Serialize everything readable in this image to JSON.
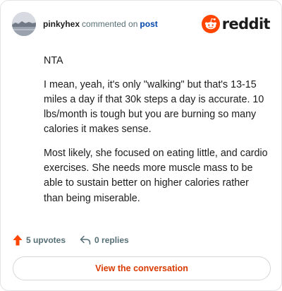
{
  "header": {
    "username": "pinkyhex",
    "action": "commented on",
    "target": "post",
    "brand_wordmark": "reddit",
    "avatar_icon": "user-avatar-landscape",
    "brand_icon": "reddit-alien-icon",
    "brand_color": "#ff4500"
  },
  "comment": {
    "paragraphs": [
      "NTA",
      "I mean, yeah, it's only \"walking\" but that's 13-15 miles a day if that 30k steps a day is accurate. 10 lbs/month is tough but you are burning so many calories it makes sense.",
      "Most likely, she focused on eating little, and cardio exercises. She needs more muscle mass to be able to sustain better on higher calories rather than being miserable."
    ]
  },
  "footer": {
    "upvotes_label": "5 upvotes",
    "replies_label": "0 replies",
    "cta_label": "View the conversation",
    "upvote_icon": "upvote-arrow-icon",
    "reply_icon": "reply-arrow-icon",
    "accent_color": "#d93a00"
  }
}
